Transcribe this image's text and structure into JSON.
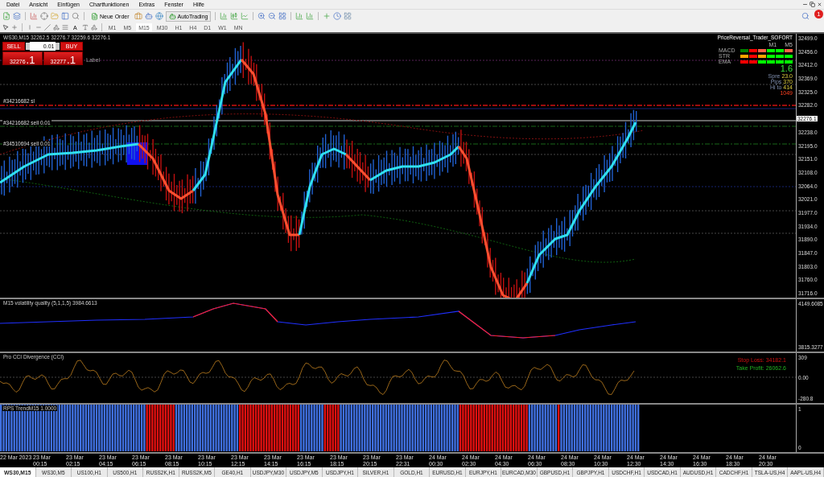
{
  "menu": [
    {
      "label": "Datei"
    },
    {
      "label": "Ansicht"
    },
    {
      "label": "Einfügen"
    },
    {
      "label": "Chartfunktionen"
    },
    {
      "label": "Extras"
    },
    {
      "label": "Fenster"
    },
    {
      "label": "Hilfe"
    }
  ],
  "toolbar": {
    "new_order": "Neue Order",
    "autotrading": "AutoTrading",
    "text_tool": "A",
    "notification_count": "1",
    "timeframes": [
      {
        "label": "M1",
        "selected": false
      },
      {
        "label": "M5",
        "selected": false
      },
      {
        "label": "M15",
        "selected": true
      },
      {
        "label": "M30",
        "selected": false
      },
      {
        "label": "H1",
        "selected": false
      },
      {
        "label": "H4",
        "selected": false
      },
      {
        "label": "D1",
        "selected": false
      },
      {
        "label": "W1",
        "selected": false
      },
      {
        "label": "MN",
        "selected": false
      }
    ]
  },
  "chart": {
    "header": "WS30,M15  32262.5 32276.7 32259.6 32276.1",
    "trade_panel": {
      "sell": "SELL",
      "buy": "BUY",
      "lots": "0.01",
      "bid_main": "32276",
      "bid_frac": ".1",
      "ask_main": "32277",
      "ask_frac": ".1"
    },
    "label": "Label",
    "order_labels": [
      "#34216682 sl",
      "#34216682 sell 0.01",
      "#34510694 sell 0.01"
    ],
    "expert": {
      "name": "PriceReversal_Trader_SOFORT",
      "columns": [
        "M1",
        "M5"
      ],
      "rows": [
        {
          "name": "MACD",
          "cells": [
            {
              "color": "#008000"
            },
            {
              "color": "#ff0000"
            },
            {
              "color": "#ff6347"
            },
            {
              "color": "#00ff00"
            },
            {
              "color": "#00ff00"
            },
            {
              "color": "#ff6347"
            }
          ]
        },
        {
          "name": "STR",
          "cells": [
            {
              "color": "#ffa500"
            },
            {
              "color": "#ff0000"
            },
            {
              "color": "#ffa500"
            },
            {
              "color": "#00ff00"
            },
            {
              "color": "#00ff00"
            },
            {
              "color": "#00ff00"
            }
          ]
        },
        {
          "name": "EMA",
          "cells": [
            {
              "color": "#ff0000"
            },
            {
              "color": "#ff0000"
            },
            {
              "color": "#00ff00"
            },
            {
              "color": "#00ff00"
            },
            {
              "color": "#00ff00"
            },
            {
              "color": "#00ff00"
            }
          ]
        }
      ],
      "value": "1.6",
      "stats": [
        {
          "label": "Spre",
          "value": "23.0"
        },
        {
          "label": "Pips",
          "value": "370"
        },
        {
          "label": "Hi to",
          "value": "414"
        }
      ],
      "extra": "1049"
    },
    "price_axis": [
      "32499.0",
      "32456.0",
      "32412.0",
      "32369.0",
      "32325.0",
      "32282.0",
      "32238.0",
      "32195.0",
      "32151.0",
      "32108.0",
      "32064.0",
      "32021.0",
      "31977.0",
      "31934.0",
      "31890.0",
      "31847.0",
      "31803.0",
      "31760.0",
      "31716.0"
    ],
    "current_price": "32276.1"
  },
  "volatility": {
    "title": "M15 volatility quality (5,1,1,5) 3984.6613",
    "axis": [
      "4149.6085",
      "3815.3277"
    ]
  },
  "cci": {
    "title": "Pro CCI Divergence (CCI)",
    "axis": [
      "309",
      "0.00",
      "-280.8"
    ],
    "stop_loss": "Stop Loss: 34182.1",
    "take_profit": "Take Profit: 26062.6"
  },
  "trend": {
    "title": "RPS TrendM15 1.0000",
    "axis": [
      "1",
      "0"
    ]
  },
  "time_axis": [
    "22 Mar 2023",
    "23 Mar 00:15",
    "23 Mar 02:15",
    "23 Mar 04:15",
    "23 Mar 06:15",
    "23 Mar 08:15",
    "23 Mar 10:15",
    "23 Mar 12:15",
    "23 Mar 14:15",
    "23 Mar 16:15",
    "23 Mar 18:15",
    "23 Mar 20:15",
    "23 Mar 22:31",
    "24 Mar 00:30",
    "24 Mar 02:30",
    "24 Mar 04:30",
    "24 Mar 06:30",
    "24 Mar 08:30",
    "24 Mar 10:30",
    "24 Mar 12:30",
    "24 Mar 14:30",
    "24 Mar 16:30",
    "24 Mar 18:30",
    "24 Mar 20:30"
  ],
  "tabs": [
    {
      "label": "WS30,M15",
      "selected": true
    },
    {
      "label": "WS30,M5",
      "selected": false
    },
    {
      "label": "US100,H1",
      "selected": false
    },
    {
      "label": "US500,H1",
      "selected": false
    },
    {
      "label": "RUSS2K,H1",
      "selected": false
    },
    {
      "label": "RUSS2K,M5",
      "selected": false
    },
    {
      "label": "GE40,H1",
      "selected": false
    },
    {
      "label": "USDJPY,M30",
      "selected": false
    },
    {
      "label": "USDJPY,M5",
      "selected": false
    },
    {
      "label": "USDJPY,H1",
      "selected": false
    },
    {
      "label": "SILVER,H1",
      "selected": false
    },
    {
      "label": "GOLD,H1",
      "selected": false
    },
    {
      "label": "EURUSD,H1",
      "selected": false
    },
    {
      "label": "EURJPY,H1",
      "selected": false
    },
    {
      "label": "EURCAD,M30",
      "selected": false
    },
    {
      "label": "GBPUSD,H1",
      "selected": false
    },
    {
      "label": "GBPJPY,H1",
      "selected": false
    },
    {
      "label": "USDCHF,H1",
      "selected": false
    },
    {
      "label": "USDCAD,H1",
      "selected": false
    },
    {
      "label": "AUDUSD,H1",
      "selected": false
    },
    {
      "label": "CADCHF,H1",
      "selected": false
    },
    {
      "label": "TSLA-US,H4",
      "selected": false
    },
    {
      "label": "AAPL-US,H4",
      "selected": false
    }
  ]
}
